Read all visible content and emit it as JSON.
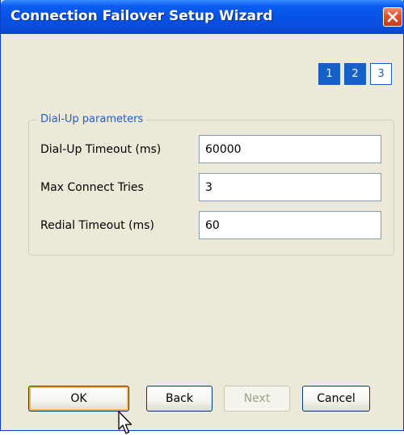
{
  "window": {
    "title": "Connection Failover Setup Wizard"
  },
  "steps": [
    {
      "label": "1",
      "state": "active"
    },
    {
      "label": "2",
      "state": "active"
    },
    {
      "label": "3",
      "state": "inactive"
    }
  ],
  "group": {
    "legend": "Dial-Up parameters",
    "fields": [
      {
        "label": "Dial-Up Timeout (ms)",
        "value": "60000"
      },
      {
        "label": "Max Connect Tries",
        "value": "3"
      },
      {
        "label": "Redial Timeout (ms)",
        "value": "60"
      }
    ]
  },
  "buttons": {
    "ok": "OK",
    "back": "Back",
    "next": "Next",
    "cancel": "Cancel"
  },
  "colors": {
    "titlebar": "#0552E6",
    "step_active": "#1660C8",
    "legend_text": "#1F5FC8",
    "dialog_bg": "#ECE9D8"
  }
}
